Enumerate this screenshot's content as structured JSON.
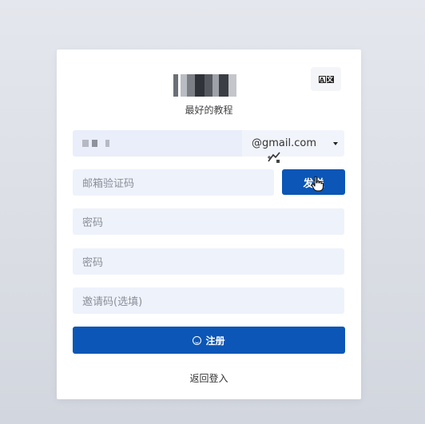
{
  "header": {
    "slogan": "最好的教程",
    "language_toggle": {
      "icon": "translate-icon",
      "glyphs": [
        "A",
        "文"
      ]
    }
  },
  "form": {
    "email": {
      "value_masked": true,
      "domain_selected": "@gmail.com"
    },
    "email_code": {
      "placeholder": "邮箱验证码"
    },
    "send_button": {
      "label": "发送"
    },
    "password": {
      "placeholder": "密码"
    },
    "password_confirm": {
      "placeholder": "密码"
    },
    "invite_code": {
      "placeholder": "邀请码(选填)"
    },
    "register_button": {
      "label": "注册",
      "icon": "smile-icon"
    },
    "back_link": {
      "label": "返回登入"
    }
  },
  "colors": {
    "primary": "#0b56b6",
    "input_bg": "#eef2fb",
    "page_bg": "#e0e3ea"
  }
}
